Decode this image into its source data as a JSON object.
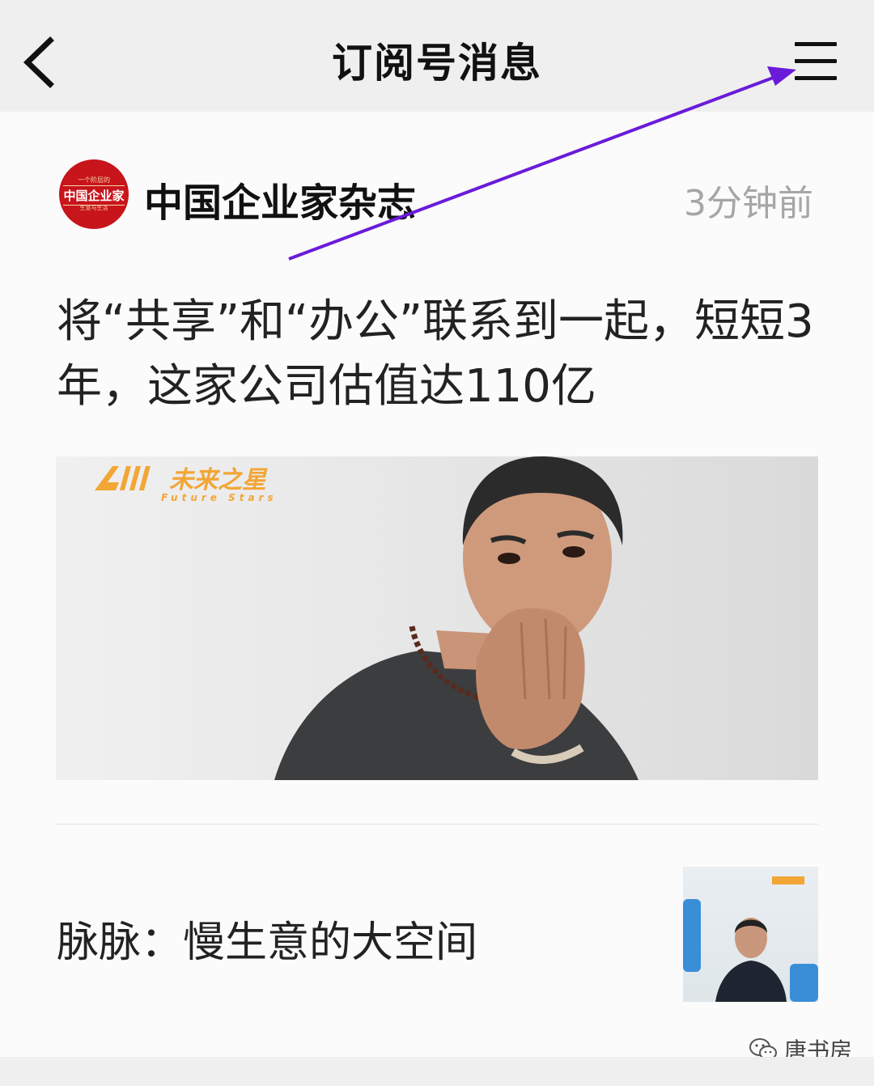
{
  "navbar": {
    "title": "订阅号消息",
    "back_icon": "chevron-left-icon",
    "menu_icon": "hamburger-menu-icon"
  },
  "message": {
    "publisher": {
      "name": "中国企业家杂志",
      "avatar_lines": [
        "一个阶层的",
        "中国企业家",
        "生意与生活"
      ]
    },
    "time": "3分钟前",
    "headline": "将“共享”和“办公”联系到一起，短短3年，这家公司估值达110亿",
    "cover": {
      "brand": "未来之星",
      "brand_sub": "Future Stars"
    },
    "sub_articles": [
      {
        "title": "脉脉：慢生意的大空间",
        "thumbnail": "person-photo-thumbnail"
      }
    ]
  },
  "watermark": {
    "icon": "wechat-icon",
    "text": "唐书房"
  },
  "colors": {
    "navbar_bg": "#efefef",
    "card_bg": "#fbfbfb",
    "annotation_arrow": "#6a1bd9",
    "timestamp": "#a6a6a6",
    "brand_orange": "#f2a635",
    "avatar_red": "#c8141b"
  }
}
